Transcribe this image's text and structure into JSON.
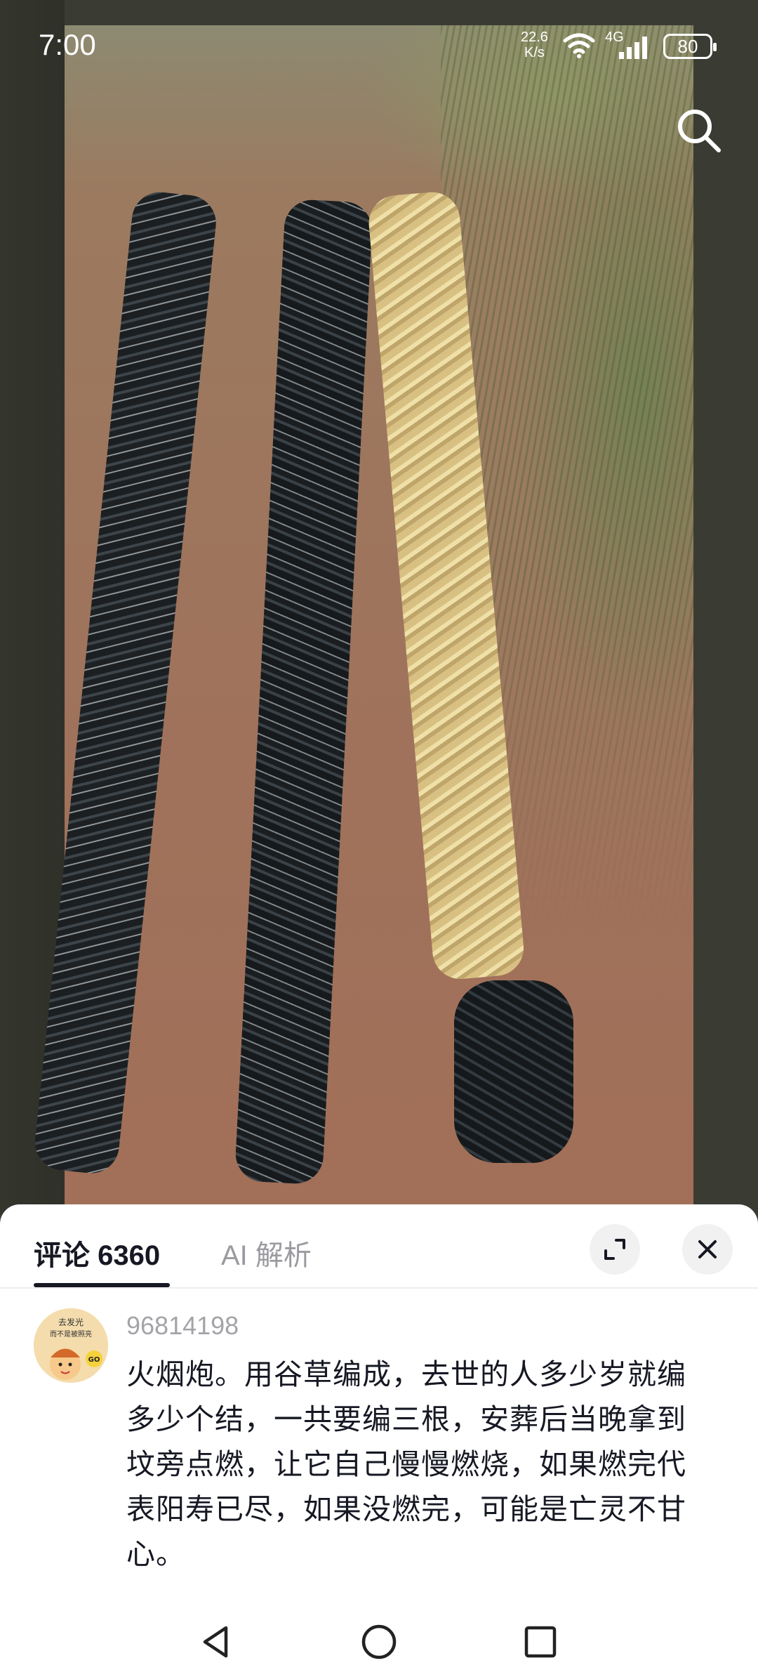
{
  "status_bar": {
    "time": "7:00",
    "net_speed_value": "22.6",
    "net_speed_unit": "K/s",
    "network_type": "4G",
    "battery": "80"
  },
  "video": {
    "icons": {
      "search": "search-icon"
    }
  },
  "comments_panel": {
    "tabs": [
      {
        "label": "评论",
        "count": "6360"
      },
      {
        "label": "AI 解析"
      }
    ],
    "buttons": {
      "expand": "expand-icon",
      "close": "close-icon"
    },
    "comment": {
      "avatar_text_line1": "去发光",
      "avatar_text_line2": "而不是被照亮",
      "avatar_badge": "GO",
      "username": "96814198",
      "text": "火烟炮。用谷草编成，去世的人多少岁就编多少个结，一共要编三根，安葬后当晚拿到坟旁点燃，让它自己慢慢燃烧，如果燃完代表阳寿已尽，如果没燃完，可能是亡灵不甘心。"
    }
  },
  "nav_bar": {
    "icons": [
      "back-icon",
      "home-icon",
      "recent-apps-icon"
    ]
  }
}
